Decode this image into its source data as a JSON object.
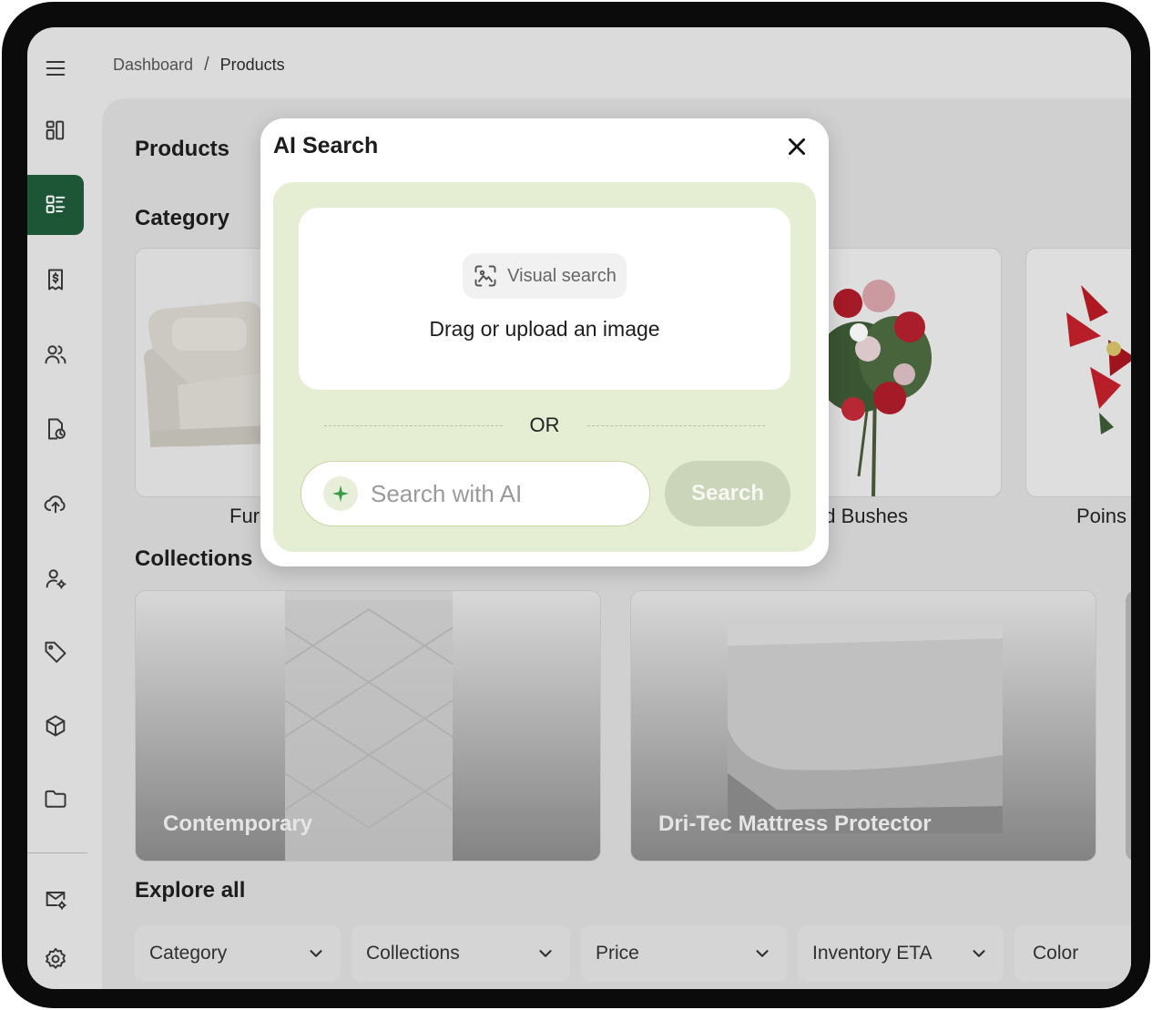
{
  "breadcrumb": {
    "items": [
      "Dashboard",
      "Products"
    ],
    "separator": "/"
  },
  "sidebar": {
    "items": [
      {
        "icon": "menu-icon"
      },
      {
        "icon": "dashboard-icon"
      },
      {
        "icon": "products-icon",
        "active": true
      },
      {
        "icon": "invoice-icon"
      },
      {
        "icon": "customers-icon"
      },
      {
        "icon": "reports-icon"
      },
      {
        "icon": "upload-icon"
      },
      {
        "icon": "user-settings-icon"
      },
      {
        "icon": "tag-icon"
      },
      {
        "icon": "box-icon"
      },
      {
        "icon": "folder-icon"
      },
      {
        "icon": "mail-settings-icon"
      },
      {
        "icon": "settings-icon"
      }
    ],
    "active_color": "#1f5c3b"
  },
  "main": {
    "title": "Products",
    "category_heading": "Category",
    "categories": [
      {
        "label": "Fur"
      },
      {
        "label": "ked Bushes"
      },
      {
        "label": "Poins"
      }
    ],
    "collections_heading": "Collections",
    "collections": [
      {
        "label": "Contemporary"
      },
      {
        "label": "Dri-Tec Mattress Protector"
      }
    ],
    "explore_heading": "Explore all",
    "filters": [
      "Category",
      "Collections",
      "Price",
      "Inventory ETA",
      "Color"
    ]
  },
  "modal": {
    "title": "AI Search",
    "visual_search_label": "Visual search",
    "drop_text": "Drag or upload an image",
    "or_text": "OR",
    "ai_input_placeholder": "Search with AI",
    "search_button": "Search",
    "accent_color": "#e5eed2"
  }
}
